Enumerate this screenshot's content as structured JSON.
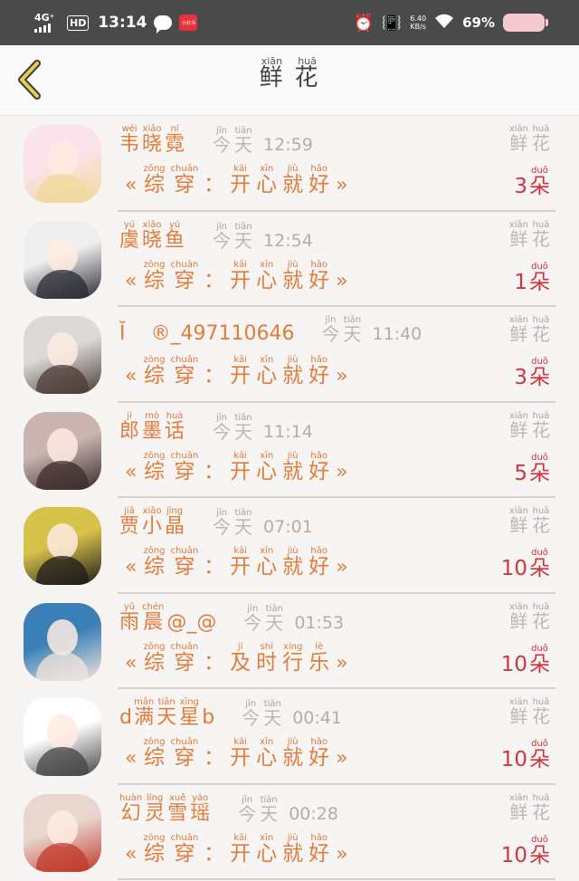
{
  "status_bar": {
    "network": "4G⁺",
    "hd": "HD",
    "time": "13:14",
    "app_icon_text": "小红书",
    "speed_value": "6.40",
    "speed_unit": "KB/s",
    "battery": "69%"
  },
  "header": {
    "title": [
      {
        "hz": "鲜",
        "py": "xiān"
      },
      {
        "hz": "花",
        "py": "huā"
      }
    ]
  },
  "list": [
    {
      "name": [
        {
          "hz": "韦",
          "py": "wéi"
        },
        {
          "hz": "晓",
          "py": "xiǎo"
        },
        {
          "hz": "霓",
          "py": "ní"
        }
      ],
      "day": [
        {
          "hz": "今",
          "py": "jīn"
        },
        {
          "hz": "天",
          "py": "tiān"
        }
      ],
      "time": "12:59",
      "message": [
        {
          "hz": "综",
          "py": "zōng"
        },
        {
          "hz": "穿",
          "py": "chuān"
        },
        {
          "hz": "：",
          "py": ""
        },
        {
          "hz": "开",
          "py": "kāi"
        },
        {
          "hz": "心",
          "py": "xīn"
        },
        {
          "hz": "就",
          "py": "jiù"
        },
        {
          "hz": "好",
          "py": "hǎo"
        }
      ],
      "flower_label": [
        {
          "hz": "鲜",
          "py": "xiān"
        },
        {
          "hz": "花",
          "py": "huā"
        }
      ],
      "count": "3",
      "unit": {
        "hz": "朵",
        "py": "duǒ"
      },
      "avatar_colors": [
        "#fbe3ec",
        "#f0d89a"
      ]
    },
    {
      "name": [
        {
          "hz": "虞",
          "py": "yú"
        },
        {
          "hz": "晓",
          "py": "xiǎo"
        },
        {
          "hz": "鱼",
          "py": "yú"
        }
      ],
      "day": [
        {
          "hz": "今",
          "py": "jīn"
        },
        {
          "hz": "天",
          "py": "tiān"
        }
      ],
      "time": "12:54",
      "message": [
        {
          "hz": "综",
          "py": "zōng"
        },
        {
          "hz": "穿",
          "py": "chuān"
        },
        {
          "hz": "：",
          "py": ""
        },
        {
          "hz": "开",
          "py": "kāi"
        },
        {
          "hz": "心",
          "py": "xīn"
        },
        {
          "hz": "就",
          "py": "jiù"
        },
        {
          "hz": "好",
          "py": "hǎo"
        }
      ],
      "flower_label": [
        {
          "hz": "鲜",
          "py": "xiān"
        },
        {
          "hz": "花",
          "py": "huā"
        }
      ],
      "count": "1",
      "unit": {
        "hz": "朵",
        "py": "duǒ"
      },
      "avatar_colors": [
        "#eeeeee",
        "#2a2a33"
      ]
    },
    {
      "name_plain": "Ĭ",
      "name_suffix": "®_497110646",
      "day": [
        {
          "hz": "今",
          "py": "jīn"
        },
        {
          "hz": "天",
          "py": "tiān"
        }
      ],
      "time": "11:40",
      "message": [
        {
          "hz": "综",
          "py": "zōng"
        },
        {
          "hz": "穿",
          "py": "chuān"
        },
        {
          "hz": "：",
          "py": ""
        },
        {
          "hz": "开",
          "py": "kāi"
        },
        {
          "hz": "心",
          "py": "xīn"
        },
        {
          "hz": "就",
          "py": "jiù"
        },
        {
          "hz": "好",
          "py": "hǎo"
        }
      ],
      "flower_label": [
        {
          "hz": "鲜",
          "py": "xiān"
        },
        {
          "hz": "花",
          "py": "huā"
        }
      ],
      "count": "3",
      "unit": {
        "hz": "朵",
        "py": "duǒ"
      },
      "avatar_colors": [
        "#dcdad8",
        "#4b3b35"
      ]
    },
    {
      "name": [
        {
          "hz": "郎",
          "py": "jí"
        },
        {
          "hz": "墨",
          "py": "mò"
        },
        {
          "hz": "话",
          "py": "huà"
        }
      ],
      "day": [
        {
          "hz": "今",
          "py": "jīn"
        },
        {
          "hz": "天",
          "py": "tiān"
        }
      ],
      "time": "11:14",
      "message": [
        {
          "hz": "综",
          "py": "zōng"
        },
        {
          "hz": "穿",
          "py": "chuān"
        },
        {
          "hz": "：",
          "py": ""
        },
        {
          "hz": "开",
          "py": "kāi"
        },
        {
          "hz": "心",
          "py": "xīn"
        },
        {
          "hz": "就",
          "py": "jiù"
        },
        {
          "hz": "好",
          "py": "hǎo"
        }
      ],
      "flower_label": [
        {
          "hz": "鲜",
          "py": "xiān"
        },
        {
          "hz": "花",
          "py": "huā"
        }
      ],
      "count": "5",
      "unit": {
        "hz": "朵",
        "py": "duǒ"
      },
      "avatar_colors": [
        "#c9b4b0",
        "#3b2b2a"
      ]
    },
    {
      "name": [
        {
          "hz": "贾",
          "py": "jiǎ"
        },
        {
          "hz": "小",
          "py": "xiǎo"
        },
        {
          "hz": "晶",
          "py": "jīng"
        }
      ],
      "day": [
        {
          "hz": "今",
          "py": "jīn"
        },
        {
          "hz": "天",
          "py": "tiān"
        }
      ],
      "time": "07:01",
      "message": [
        {
          "hz": "综",
          "py": "zōng"
        },
        {
          "hz": "穿",
          "py": "chuān"
        },
        {
          "hz": "：",
          "py": ""
        },
        {
          "hz": "开",
          "py": "kāi"
        },
        {
          "hz": "心",
          "py": "xīn"
        },
        {
          "hz": "就",
          "py": "jiù"
        },
        {
          "hz": "好",
          "py": "hǎo"
        }
      ],
      "flower_label": [
        {
          "hz": "鲜",
          "py": "xiān"
        },
        {
          "hz": "花",
          "py": "huā"
        }
      ],
      "count": "10",
      "unit": {
        "hz": "朵",
        "py": "duǒ"
      },
      "avatar_colors": [
        "#d8c34a",
        "#1f1b1a"
      ]
    },
    {
      "name": [
        {
          "hz": "雨",
          "py": "yǔ"
        },
        {
          "hz": "晨",
          "py": "chén"
        }
      ],
      "name_suffix": "@_@",
      "day": [
        {
          "hz": "今",
          "py": "jīn"
        },
        {
          "hz": "天",
          "py": "tiān"
        }
      ],
      "time": "01:53",
      "message": [
        {
          "hz": "综",
          "py": "zōng"
        },
        {
          "hz": "穿",
          "py": "chuān"
        },
        {
          "hz": "：",
          "py": ""
        },
        {
          "hz": "及",
          "py": "jí"
        },
        {
          "hz": "时",
          "py": "shí"
        },
        {
          "hz": "行",
          "py": "xíng"
        },
        {
          "hz": "乐",
          "py": "lè"
        }
      ],
      "flower_label": [
        {
          "hz": "鲜",
          "py": "xiān"
        },
        {
          "hz": "花",
          "py": "huā"
        }
      ],
      "count": "10",
      "unit": {
        "hz": "朵",
        "py": "duǒ"
      },
      "avatar_colors": [
        "#3a7fb8",
        "#f2e6dd"
      ]
    },
    {
      "name_prefix": "d",
      "name": [
        {
          "hz": "满",
          "py": "mǎn"
        },
        {
          "hz": "天",
          "py": "tiān"
        },
        {
          "hz": "星",
          "py": "xīng"
        }
      ],
      "name_suffix": "b",
      "day": [
        {
          "hz": "今",
          "py": "jīn"
        },
        {
          "hz": "天",
          "py": "tiān"
        }
      ],
      "time": "00:41",
      "message": [
        {
          "hz": "综",
          "py": "zōng"
        },
        {
          "hz": "穿",
          "py": "chuān"
        },
        {
          "hz": "：",
          "py": ""
        },
        {
          "hz": "开",
          "py": "kāi"
        },
        {
          "hz": "心",
          "py": "xīn"
        },
        {
          "hz": "就",
          "py": "jiù"
        },
        {
          "hz": "好",
          "py": "hǎo"
        }
      ],
      "flower_label": [
        {
          "hz": "鲜",
          "py": "xiān"
        },
        {
          "hz": "花",
          "py": "huā"
        }
      ],
      "count": "10",
      "unit": {
        "hz": "朵",
        "py": "duǒ"
      },
      "avatar_colors": [
        "#ffffff",
        "#444444"
      ]
    },
    {
      "name": [
        {
          "hz": "幻",
          "py": "huàn"
        },
        {
          "hz": "灵",
          "py": "líng"
        },
        {
          "hz": "雪",
          "py": "xuě"
        },
        {
          "hz": "瑶",
          "py": "yáo"
        }
      ],
      "day": [
        {
          "hz": "今",
          "py": "jīn"
        },
        {
          "hz": "天",
          "py": "tiān"
        }
      ],
      "time": "00:28",
      "message": [
        {
          "hz": "综",
          "py": "zōng"
        },
        {
          "hz": "穿",
          "py": "chuān"
        },
        {
          "hz": "：",
          "py": ""
        },
        {
          "hz": "开",
          "py": "kāi"
        },
        {
          "hz": "心",
          "py": "xīn"
        },
        {
          "hz": "就",
          "py": "jiù"
        },
        {
          "hz": "好",
          "py": "hǎo"
        }
      ],
      "flower_label": [
        {
          "hz": "鲜",
          "py": "xiān"
        },
        {
          "hz": "花",
          "py": "huā"
        }
      ],
      "count": "10",
      "unit": {
        "hz": "朵",
        "py": "duǒ"
      },
      "avatar_colors": [
        "#e8d6cf",
        "#c0392b"
      ]
    }
  ],
  "quote_open": "«",
  "quote_close": "»",
  "colors": {
    "name": "#e07d3a",
    "count": "#d0353f",
    "muted": "#bdb7b7",
    "back_arrow": "#e8c85a"
  }
}
